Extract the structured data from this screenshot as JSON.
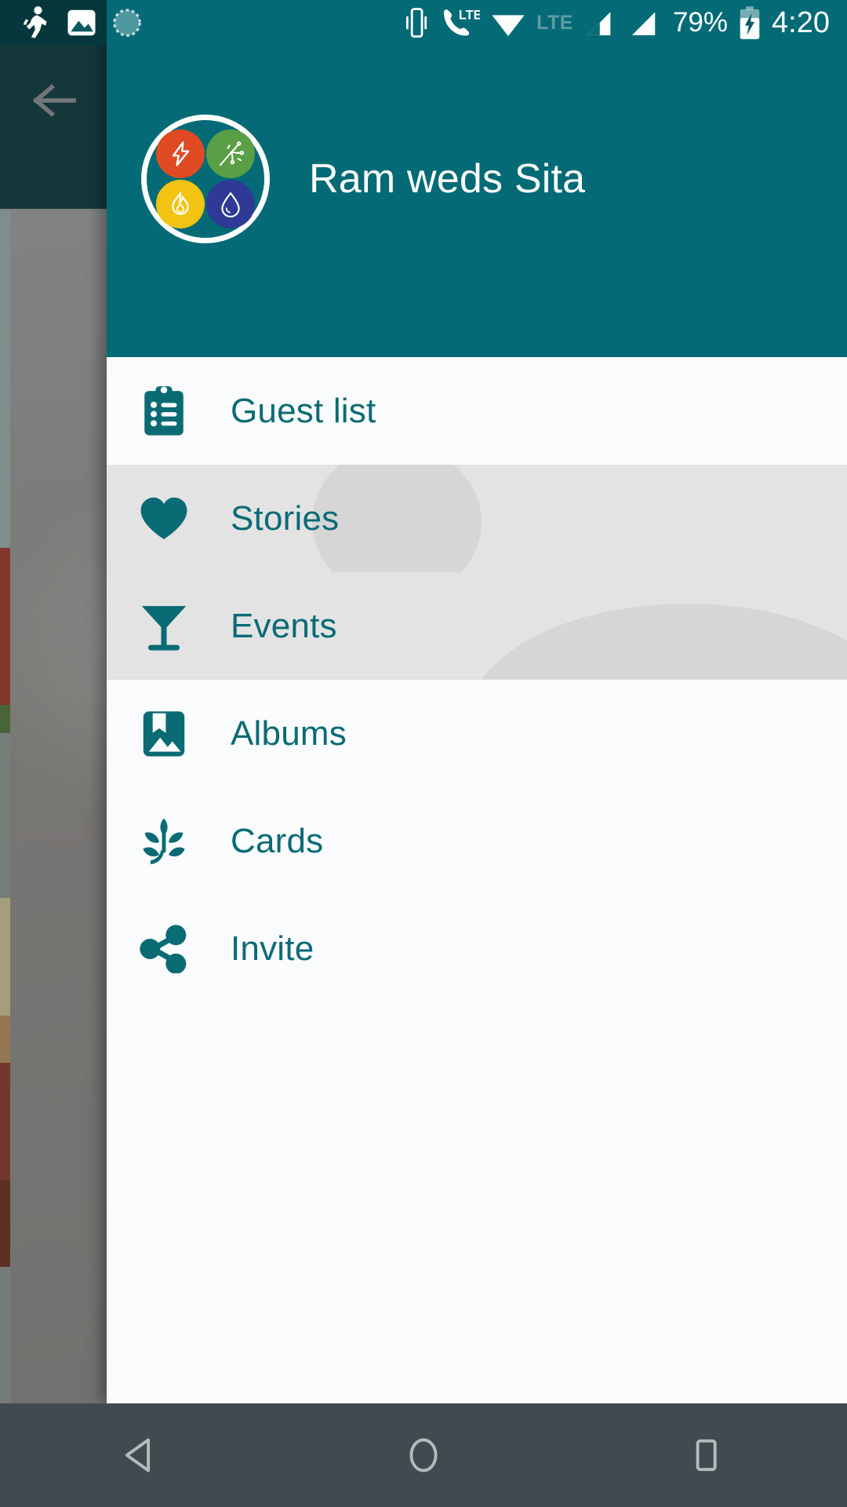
{
  "status_bar": {
    "background_color": "#046b76",
    "notification_icons": [
      {
        "name": "running-person-icon"
      },
      {
        "name": "photo-icon"
      },
      {
        "name": "sync-progress-icon"
      }
    ],
    "system_icons": [
      {
        "name": "vibrate-icon"
      },
      {
        "name": "volte-call-icon",
        "label": "LTE"
      },
      {
        "name": "wifi-icon"
      },
      {
        "name": "lte-dim-icon",
        "label": "LTE"
      },
      {
        "name": "signal-sim1-icon"
      },
      {
        "name": "signal-sim2-icon"
      }
    ],
    "battery_percent": "79%",
    "battery_icon": "battery-charging-icon",
    "clock": "4:20"
  },
  "background_activity": {
    "back_button_label": "back-arrow",
    "toolbar_color": "#06373c"
  },
  "drawer": {
    "header": {
      "title": "Ram weds Sita",
      "background_color": "#046b76",
      "avatar": {
        "name": "event-avatar",
        "badges": [
          {
            "icon": "lightning-bolt-icon",
            "color": "#e04a23"
          },
          {
            "icon": "sparkler-firework-icon",
            "color": "#5a9e46"
          },
          {
            "icon": "flame-icon",
            "color": "#f2c313"
          },
          {
            "icon": "water-drop-icon",
            "color": "#2e3a96"
          }
        ]
      }
    },
    "accent_color": "#0b6b75",
    "items": [
      {
        "id": "guest-list",
        "label": "Guest list",
        "icon": "clipboard-list-icon",
        "pressed": false
      },
      {
        "id": "stories",
        "label": "Stories",
        "icon": "heart-icon",
        "pressed": true
      },
      {
        "id": "events",
        "label": "Events",
        "icon": "cocktail-glass-icon",
        "pressed": true
      },
      {
        "id": "albums",
        "label": "Albums",
        "icon": "photo-album-icon",
        "pressed": false
      },
      {
        "id": "cards",
        "label": "Cards",
        "icon": "leaf-branch-icon",
        "pressed": false
      },
      {
        "id": "invite",
        "label": "Invite",
        "icon": "share-icon",
        "pressed": false
      }
    ]
  },
  "nav_bar": {
    "background_color": "#414a4f",
    "buttons": [
      {
        "id": "back",
        "icon": "nav-back-triangle-icon"
      },
      {
        "id": "home",
        "icon": "nav-home-circle-icon"
      },
      {
        "id": "recents",
        "icon": "nav-recents-square-icon"
      }
    ]
  }
}
